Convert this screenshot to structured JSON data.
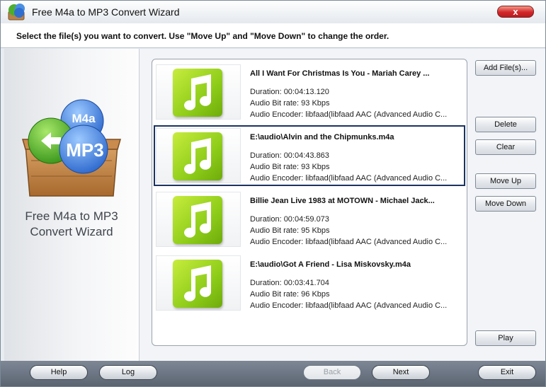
{
  "window": {
    "title": "Free M4a to MP3 Convert Wizard",
    "close_label": "x"
  },
  "instruction": "Select the file(s) you want to convert. Use \"Move Up\" and \"Move Down\" to change the order.",
  "logo": {
    "m4a_label": "M4a",
    "mp3_label": "MP3",
    "caption_line1": "Free M4a to MP3",
    "caption_line2": "Convert Wizard"
  },
  "files": [
    {
      "name": "All I Want For Christmas Is You - Mariah Carey ...",
      "duration": "Duration: 00:04:13.120",
      "bitrate": "Audio Bit rate: 93 Kbps",
      "encoder": "Audio Encoder: libfaad(libfaad AAC (Advanced Audio C..."
    },
    {
      "name": "E:\\audio\\Alvin and the Chipmunks.m4a",
      "duration": "Duration: 00:04:43.863",
      "bitrate": "Audio Bit rate: 93 Kbps",
      "encoder": "Audio Encoder: libfaad(libfaad AAC (Advanced Audio C..."
    },
    {
      "name": "Billie Jean Live 1983 at MOTOWN - Michael Jack...",
      "duration": "Duration: 00:04:59.073",
      "bitrate": "Audio Bit rate: 95 Kbps",
      "encoder": "Audio Encoder: libfaad(libfaad AAC (Advanced Audio C..."
    },
    {
      "name": "E:\\audio\\Got A Friend - Lisa Miskovsky.m4a",
      "duration": "Duration: 00:03:41.704",
      "bitrate": "Audio Bit rate: 96 Kbps",
      "encoder": "Audio Encoder: libfaad(libfaad AAC (Advanced Audio C..."
    }
  ],
  "buttons": {
    "add_files": "Add File(s)...",
    "delete": "Delete",
    "clear": "Clear",
    "move_up": "Move Up",
    "move_down": "Move Down",
    "play": "Play"
  },
  "bottom": {
    "help": "Help",
    "log": "Log",
    "back": "Back",
    "next": "Next",
    "exit": "Exit"
  },
  "colors": {
    "selection_border": "#1b3360",
    "note_tile": "#8fcd1a",
    "bottom_bar": "#5b6572"
  }
}
